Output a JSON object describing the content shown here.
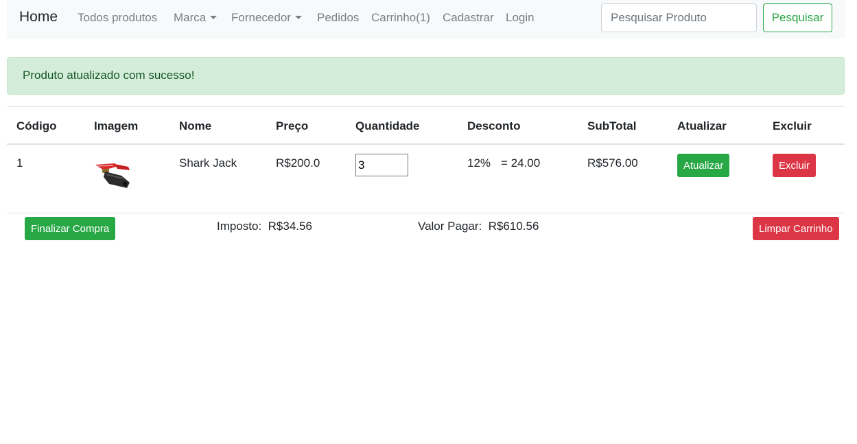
{
  "navbar": {
    "brand": "Home",
    "links": {
      "todos_produtos": "Todos produtos",
      "marca": "Marca",
      "fornecedor": "Fornecedor",
      "pedidos": "Pedidos",
      "carrinho": "Carrinho(1)",
      "cadastrar": "Cadastrar",
      "login": "Login"
    },
    "search": {
      "placeholder": "Pesquisar Produto",
      "value": "",
      "button": "Pesquisar"
    }
  },
  "alert": {
    "message": "Produto atualizado com sucesso!"
  },
  "table": {
    "headers": {
      "codigo": "Código",
      "imagem": "Imagem",
      "nome": "Nome",
      "preco": "Preço",
      "quantidade": "Quantidade",
      "desconto": "Desconto",
      "subtotal": "SubTotal",
      "atualizar": "Atualizar",
      "excluir": "Excluir"
    },
    "rows": [
      {
        "codigo": "1",
        "nome": "Shark Jack",
        "preco": "R$200.0",
        "quantidade": "3",
        "desconto_pct": "12%",
        "desconto_valor": "= 24.00",
        "subtotal": "R$576.00",
        "atualizar_label": "Atualizar",
        "excluir_label": "Excluir"
      }
    ]
  },
  "footer": {
    "finalizar": "Finalizar Compra",
    "imposto_label": "Imposto:",
    "imposto_value": "R$34.56",
    "valor_label": "Valor Pagar:",
    "valor_value": "R$610.56",
    "limpar": "Limpar Carrinho"
  },
  "colors": {
    "success": "#28a745",
    "danger": "#dc3545",
    "alert_bg": "#d4edda",
    "alert_text": "#155724",
    "navbar_bg": "#f8f9fa"
  },
  "icons": {
    "product_image": "product-photo",
    "dropdown": "caret-down-icon"
  }
}
